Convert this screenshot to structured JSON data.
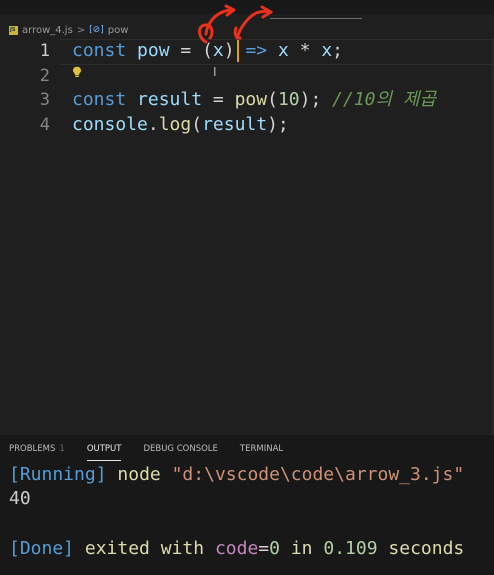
{
  "breadcrumb": {
    "file": "arrow_4.js",
    "separator": ">",
    "symbol_icon": "symbol-variable-icon",
    "symbol": "pow"
  },
  "editor": {
    "lines": [
      {
        "number": "1",
        "tokens": [
          {
            "t": "const",
            "c": "kw"
          },
          {
            "t": " ",
            "c": "op"
          },
          {
            "t": "pow",
            "c": "var"
          },
          {
            "t": " = ",
            "c": "op"
          },
          {
            "t": "(",
            "c": "pn"
          },
          {
            "t": "x",
            "c": "var"
          },
          {
            "t": ")",
            "c": "pn"
          },
          {
            "t": " ",
            "c": "op"
          },
          {
            "t": "=>",
            "c": "kw"
          },
          {
            "t": " ",
            "c": "op"
          },
          {
            "t": "x",
            "c": "var"
          },
          {
            "t": " * ",
            "c": "op"
          },
          {
            "t": "x",
            "c": "var"
          },
          {
            "t": ";",
            "c": "op"
          }
        ]
      },
      {
        "number": "2",
        "tokens": []
      },
      {
        "number": "3",
        "tokens": [
          {
            "t": "const",
            "c": "kw"
          },
          {
            "t": " ",
            "c": "op"
          },
          {
            "t": "result",
            "c": "var"
          },
          {
            "t": " = ",
            "c": "op"
          },
          {
            "t": "pow",
            "c": "fn"
          },
          {
            "t": "(",
            "c": "pn"
          },
          {
            "t": "10",
            "c": "num"
          },
          {
            "t": ");",
            "c": "pn"
          },
          {
            "t": " ",
            "c": "op"
          },
          {
            "t": "//10의 제곱",
            "c": "cmt"
          }
        ]
      },
      {
        "number": "4",
        "tokens": [
          {
            "t": "console",
            "c": "var"
          },
          {
            "t": ".",
            "c": "op"
          },
          {
            "t": "log",
            "c": "fn"
          },
          {
            "t": "(",
            "c": "pn"
          },
          {
            "t": "result",
            "c": "var"
          },
          {
            "t": ");",
            "c": "pn"
          }
        ]
      }
    ],
    "lightbulb_icon": "lightbulb-icon",
    "mouse_cursor_icon": "ibeam-cursor-icon"
  },
  "panel": {
    "tabs": [
      {
        "label": "PROBLEMS",
        "badge": "1",
        "active": false
      },
      {
        "label": "OUTPUT",
        "active": true
      },
      {
        "label": "DEBUG CONSOLE",
        "active": false
      },
      {
        "label": "TERMINAL",
        "active": false
      }
    ],
    "output": {
      "running_tag": "[Running]",
      "command": "node",
      "path": "\"d:\\vscode\\code\\arrow_3.js\"",
      "result": "40",
      "done_tag": "[Done]",
      "exited_text": "exited with",
      "code_label": "code",
      "code_eq": "=",
      "code_value": "0",
      "in_text": "in",
      "seconds_value": "0.109",
      "seconds_text": "seconds"
    }
  },
  "colors": {
    "annotation_red": "#e8321e",
    "caret": "#e6a100"
  }
}
